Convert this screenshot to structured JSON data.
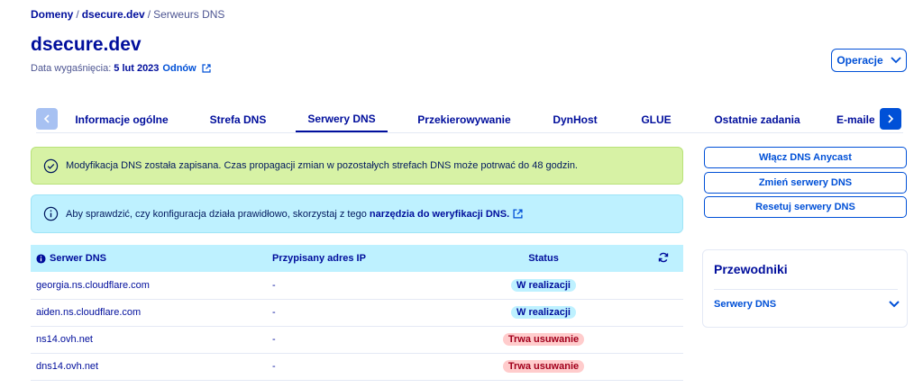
{
  "breadcrumb": {
    "items": [
      "Domeny",
      "dsecure.dev",
      "Serweurs DNS"
    ],
    "separator": "/"
  },
  "page": {
    "title": "dsecure.dev",
    "expiry_label": "Data wygaśnięcia:",
    "expiry_date": "5 lut 2023",
    "renew_label": "Odnów"
  },
  "header": {
    "operations_label": "Operacje"
  },
  "tabs": [
    {
      "label": "Informacje ogólne"
    },
    {
      "label": "Strefa DNS"
    },
    {
      "label": "Serwery DNS"
    },
    {
      "label": "Przekierowywanie"
    },
    {
      "label": "DynHost"
    },
    {
      "label": "GLUE"
    },
    {
      "label": "Ostatnie zadania"
    },
    {
      "label": "E-maile"
    }
  ],
  "alerts": {
    "success_text": "Modyfikacja DNS została zapisana. Czas propagacji zmian w pozostałych strefach DNS może potrwać do 48 godzin.",
    "info_text": "Aby sprawdzić, czy konfiguracja działa prawidłowo, skorzystaj z tego",
    "info_link": "narzędzia do weryfikacji DNS."
  },
  "table": {
    "headers": [
      "Serwer DNS",
      "Przypisany adres IP",
      "Status"
    ],
    "rows": [
      {
        "server": "georgia.ns.cloudflare.com",
        "ip": "-",
        "status": "W realizacji"
      },
      {
        "server": "aiden.ns.cloudflare.com",
        "ip": "-",
        "status": "W realizacji"
      },
      {
        "server": "ns14.ovh.net",
        "ip": "-",
        "status": "Trwa usuwanie"
      },
      {
        "server": "dns14.ovh.net",
        "ip": "-",
        "status": "Trwa usuwanie"
      }
    ]
  },
  "side_actions": {
    "anycast": "Włącz DNS Anycast",
    "change": "Zmień serwery DNS",
    "reset": "Resetuj serwery DNS"
  },
  "guides": {
    "title": "Przewodniki",
    "item": "Serwery DNS"
  },
  "colors": {
    "primary": "#0050d7",
    "navy": "#000e9c",
    "success_bg": "#d7f2a5",
    "info_bg": "#bef1ff",
    "danger_bg": "#ffcccc",
    "danger_text": "#a2001c"
  }
}
